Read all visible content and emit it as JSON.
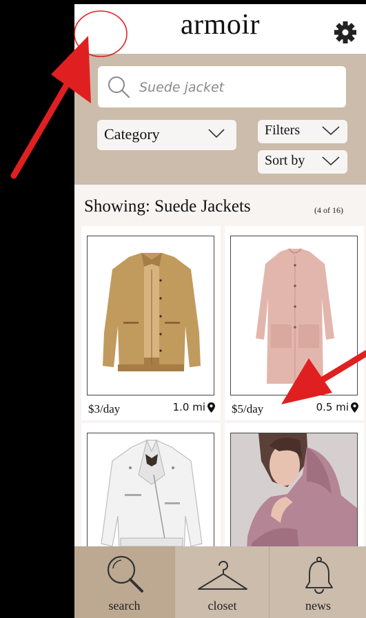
{
  "header": {
    "title": "armoir",
    "settings_icon": "gear-icon"
  },
  "search": {
    "placeholder": "Suede jacket",
    "value": ""
  },
  "filters": {
    "category_label": "Category",
    "filters_label": "Filters",
    "sort_label": "Sort by"
  },
  "results": {
    "title": "Showing: Suede Jackets",
    "count": "(4 of 16)",
    "items": [
      {
        "price": "$3/day",
        "distance": "1.0 mi",
        "image": "tan-suede-jacket"
      },
      {
        "price": "$5/day",
        "distance": "0.5 mi",
        "image": "pink-suede-coat"
      },
      {
        "price": "",
        "distance": "",
        "image": "white-leather-jacket"
      },
      {
        "price": "",
        "distance": "",
        "image": "mauve-hoodie"
      }
    ]
  },
  "nav": {
    "items": [
      {
        "label": "search",
        "icon": "search-icon"
      },
      {
        "label": "closet",
        "icon": "hanger-icon"
      },
      {
        "label": "news",
        "icon": "bell-icon"
      }
    ]
  },
  "colors": {
    "panel": "#cbbcab",
    "nav_active": "#bda992",
    "annotation": "#e02020",
    "background": "#000000"
  }
}
